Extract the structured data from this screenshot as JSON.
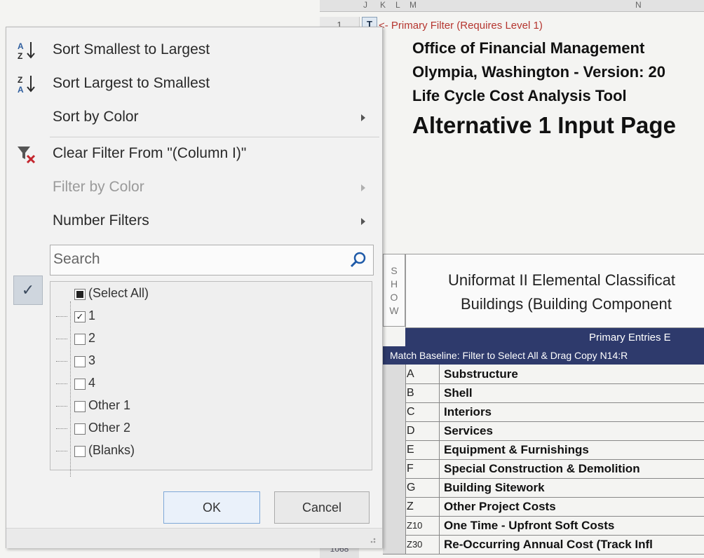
{
  "sheet": {
    "columns": [
      "J",
      "K",
      "L",
      "M",
      "N"
    ],
    "row1_number": "1",
    "filter_button_glyph": "T",
    "primary_filter_note": "<- Primary Filter (Requires Level 1)",
    "header_lines": [
      "Office of Financial Management",
      "Olympia, Washington - Version: 20",
      "Life Cycle Cost Analysis Tool"
    ],
    "page_title": "Alternative 1 Input Page",
    "show_letters": [
      "S",
      "H",
      "O",
      "W"
    ],
    "uniformat_line1": "Uniformat II Elemental Classificat",
    "uniformat_line2": "Buildings (Building Component",
    "primary_entries": "Primary Entries E",
    "match_baseline": "Match Baseline: Filter to Select All & Drag Copy N14:R",
    "rows": [
      {
        "code": "A",
        "name": "Substructure"
      },
      {
        "code": "B",
        "name": "Shell"
      },
      {
        "code": "C",
        "name": "Interiors"
      },
      {
        "code": "D",
        "name": "Services"
      },
      {
        "code": "E",
        "name": "Equipment & Furnishings"
      },
      {
        "code": "F",
        "name": "Special Construction & Demolition"
      },
      {
        "code": "G",
        "name": "Building Sitework"
      },
      {
        "code": "Z",
        "name": "Other Project Costs"
      },
      {
        "code": "Z10",
        "name": "One Time - Upfront Soft Costs"
      },
      {
        "code": "Z30",
        "name": "Re-Occurring Annual Cost (Track Infl"
      }
    ],
    "bottom_row_number": "1068"
  },
  "menu": {
    "sort_asc": "Sort Smallest to Largest",
    "sort_desc": "Sort Largest to Smallest",
    "sort_color": "Sort by Color",
    "clear_filter": "Clear Filter From \"(Column I)\"",
    "filter_color": "Filter by Color",
    "number_filters": "Number Filters",
    "search_placeholder": "Search",
    "list": [
      {
        "label": "(Select All)",
        "state": "indeterminate"
      },
      {
        "label": "1",
        "state": "checked"
      },
      {
        "label": "2",
        "state": "unchecked"
      },
      {
        "label": "3",
        "state": "unchecked"
      },
      {
        "label": "4",
        "state": "unchecked"
      },
      {
        "label": "Other 1",
        "state": "unchecked"
      },
      {
        "label": "Other 2",
        "state": "unchecked"
      },
      {
        "label": "(Blanks)",
        "state": "unchecked"
      }
    ],
    "ok_label": "OK",
    "cancel_label": "Cancel"
  },
  "colors": {
    "accent": "#2e3a6c",
    "primary_note": "#b5352f",
    "icon_blue": "#2f5e9e",
    "clear_filter_x": "#c4262e"
  }
}
